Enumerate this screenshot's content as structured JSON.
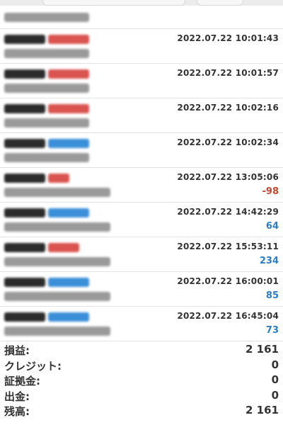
{
  "orders": [
    {
      "timestamp": "",
      "profit": "",
      "type": "none"
    },
    {
      "timestamp": "2022.07.22 10:01:43",
      "profit": "",
      "type": "sell"
    },
    {
      "timestamp": "2022.07.22 10:01:57",
      "profit": "",
      "type": "sell"
    },
    {
      "timestamp": "2022.07.22 10:02:16",
      "profit": "",
      "type": "sell"
    },
    {
      "timestamp": "2022.07.22 10:02:34",
      "profit": "",
      "type": "buy"
    },
    {
      "timestamp": "2022.07.22 13:05:06",
      "profit": "-98",
      "type": "sell"
    },
    {
      "timestamp": "2022.07.22 14:42:29",
      "profit": "64",
      "type": "buy"
    },
    {
      "timestamp": "2022.07.22 15:53:11",
      "profit": "234",
      "type": "sell"
    },
    {
      "timestamp": "2022.07.22 16:00:01",
      "profit": "85",
      "type": "buy"
    },
    {
      "timestamp": "2022.07.22 16:45:04",
      "profit": "73",
      "type": "buy"
    }
  ],
  "summary": {
    "profit_label": "損益:",
    "profit_value": "2 161",
    "credit_label": "クレジット:",
    "credit_value": "0",
    "margin_label": "証拠金:",
    "margin_value": "0",
    "withdrawal_label": "出金:",
    "withdrawal_value": "0",
    "balance_label": "残高:",
    "balance_value": "2 161"
  },
  "colors": {
    "sell": "#d9534f",
    "buy": "#3a8fd8",
    "loss": "#c8462c",
    "gain": "#2a7fc6"
  }
}
